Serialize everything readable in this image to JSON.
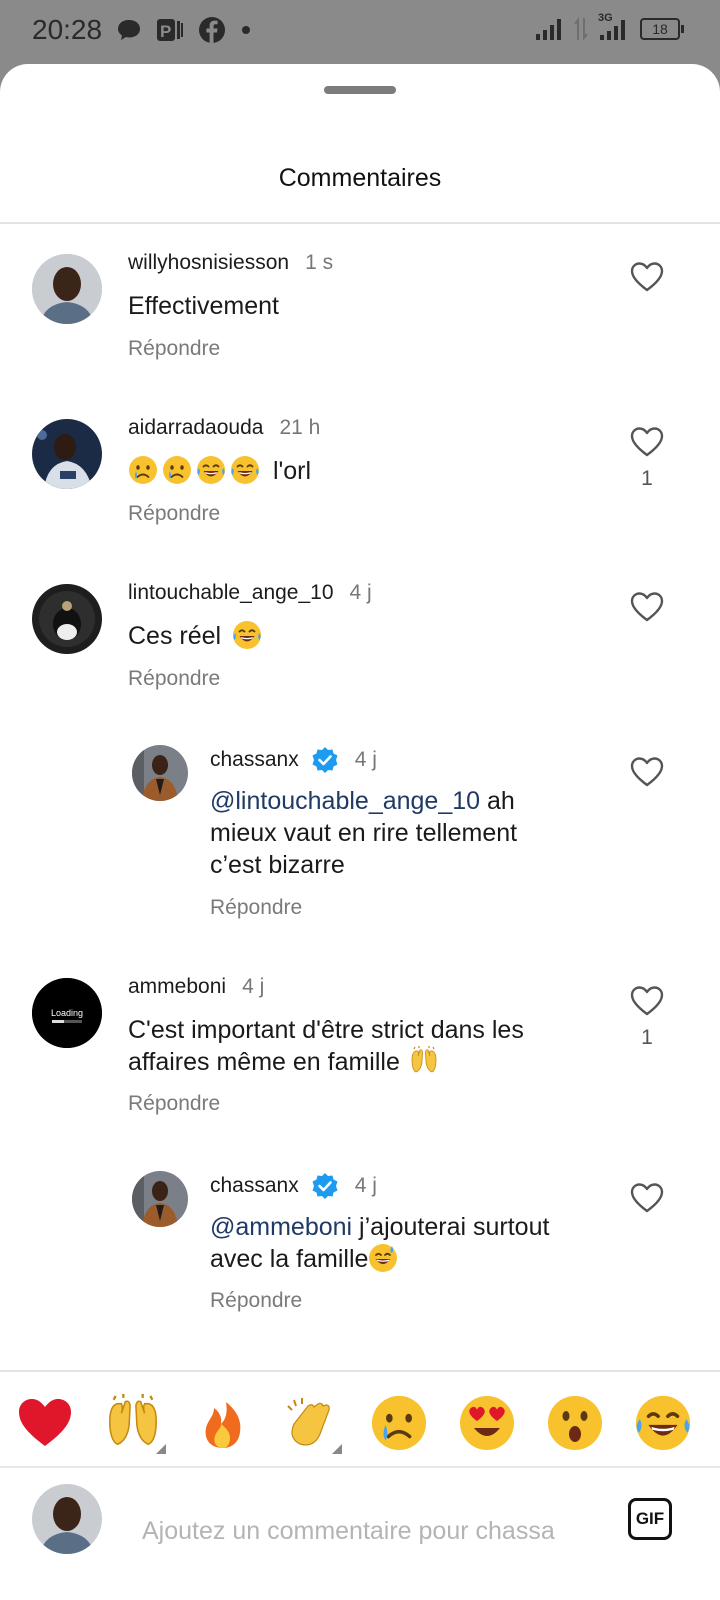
{
  "status_bar": {
    "time": "20:28",
    "network_label": "3G",
    "battery": "18",
    "icons": [
      "chat-bubble-icon",
      "parking-icon",
      "facebook-icon",
      "dot-icon",
      "signal-icon",
      "data-arrows-icon",
      "signal-3g-icon",
      "battery-icon"
    ]
  },
  "sheet": {
    "title": "Commentaires"
  },
  "comments": [
    {
      "username": "willyhosnisiesson",
      "time": "1 s",
      "text": "Effectivement",
      "reply_label": "Répondre",
      "like_count": ""
    },
    {
      "username": "aidarradaouda",
      "time": "21 h",
      "text": "l'orl",
      "emojis": [
        "crying-face",
        "crying-face",
        "tears-of-joy-face",
        "tears-of-joy-face"
      ],
      "reply_label": "Répondre",
      "like_count": "1"
    },
    {
      "username": "lintouchable_ange_10",
      "time": "4 j",
      "text": "Ces réel",
      "emojis": [
        "tears-of-joy-face"
      ],
      "reply_label": "Répondre",
      "like_count": ""
    },
    {
      "username": "chassanx",
      "verified": true,
      "time": "4 j",
      "mention": "@lintouchable_ange_10",
      "text_line1": " ah",
      "text_line2": "mieux vaut en rire tellement",
      "text_line3": "c’est bizarre",
      "reply_label": "Répondre",
      "like_count": ""
    },
    {
      "username": "ammeboni",
      "avatar_text": "Loading",
      "time": "4 j",
      "text_line1": "C'est important d'être strict dans les",
      "text_line2": "affaires même en famille",
      "emojis": [
        "raising-hands"
      ],
      "reply_label": "Répondre",
      "like_count": "1"
    },
    {
      "username": "chassanx",
      "verified": true,
      "time": "4 j",
      "mention": "@ammeboni",
      "text_line1": " j’ajouterai surtout",
      "text_line2": "avec la famille",
      "emojis": [
        "grinning-sweat-face"
      ],
      "reply_label": "Répondre",
      "like_count": ""
    }
  ],
  "reactions": [
    "red-heart",
    "raising-hands",
    "fire",
    "clapping-hands",
    "crying-face",
    "heart-eyes-face",
    "surprised-face",
    "tears-of-joy-face"
  ],
  "input": {
    "placeholder": "Ajoutez un commentaire pour chassa",
    "gif_label": "GIF"
  },
  "colors": {
    "mention": "#1f3a66",
    "verified": "#1d9bf0",
    "heart": "#e0162b"
  }
}
